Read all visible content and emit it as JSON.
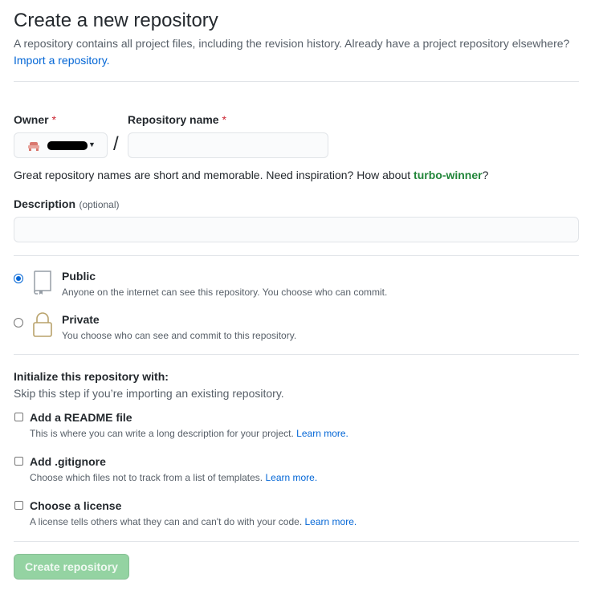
{
  "header": {
    "title": "Create a new repository",
    "description": "A repository contains all project files, including the revision history. Already have a project repository elsewhere?",
    "import_link": "Import a repository."
  },
  "owner": {
    "label": "Owner",
    "required_mark": "*"
  },
  "repo_name": {
    "label": "Repository name",
    "required_mark": "*",
    "value": "",
    "separator": "/"
  },
  "suggestion": {
    "text": "Great repository names are short and memorable. Need inspiration? How about",
    "name": "turbo-winner",
    "end": "?"
  },
  "description_field": {
    "label": "Description",
    "optional": "(optional)",
    "value": ""
  },
  "visibility": {
    "public": {
      "title": "Public",
      "desc": "Anyone on the internet can see this repository. You choose who can commit.",
      "selected": true
    },
    "private": {
      "title": "Private",
      "desc": "You choose who can see and commit to this repository.",
      "selected": false
    }
  },
  "init": {
    "title": "Initialize this repository with:",
    "subtitle": "Skip this step if you’re importing an existing repository.",
    "learn_more": "Learn more.",
    "options": [
      {
        "label": "Add a README file",
        "desc": "This is where you can write a long description for your project.",
        "checked": false
      },
      {
        "label": "Add .gitignore",
        "desc": "Choose which files not to track from a list of templates.",
        "checked": false
      },
      {
        "label": "Choose a license",
        "desc": "A license tells others what they can and can't do with your code.",
        "checked": false
      }
    ]
  },
  "submit": {
    "label": "Create repository",
    "enabled": false
  },
  "colors": {
    "accent": "#0366d6",
    "suggestion": "#22863a",
    "button_disabled_bg": "#94d3a2",
    "required": "#cb2431"
  }
}
